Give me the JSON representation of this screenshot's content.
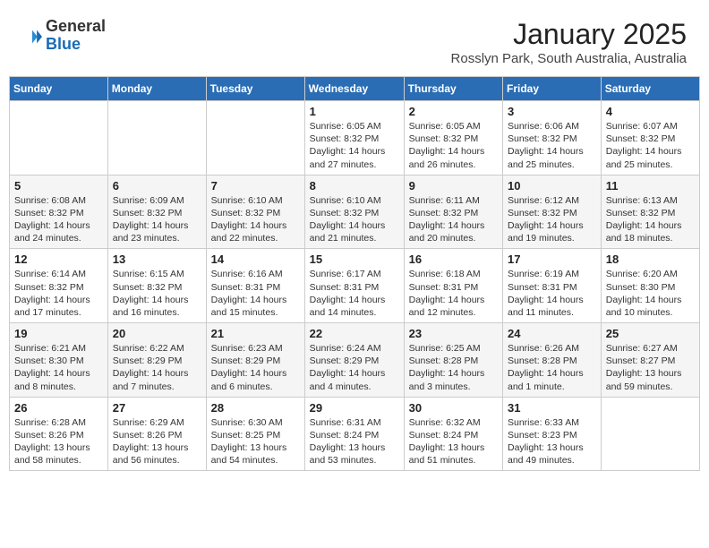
{
  "header": {
    "logo": {
      "general": "General",
      "blue": "Blue"
    },
    "title": "January 2025",
    "subtitle": "Rosslyn Park, South Australia, Australia"
  },
  "calendar": {
    "days_of_week": [
      "Sunday",
      "Monday",
      "Tuesday",
      "Wednesday",
      "Thursday",
      "Friday",
      "Saturday"
    ],
    "weeks": [
      [
        {
          "day": "",
          "info": ""
        },
        {
          "day": "",
          "info": ""
        },
        {
          "day": "",
          "info": ""
        },
        {
          "day": "1",
          "info": "Sunrise: 6:05 AM\nSunset: 8:32 PM\nDaylight: 14 hours\nand 27 minutes."
        },
        {
          "day": "2",
          "info": "Sunrise: 6:05 AM\nSunset: 8:32 PM\nDaylight: 14 hours\nand 26 minutes."
        },
        {
          "day": "3",
          "info": "Sunrise: 6:06 AM\nSunset: 8:32 PM\nDaylight: 14 hours\nand 25 minutes."
        },
        {
          "day": "4",
          "info": "Sunrise: 6:07 AM\nSunset: 8:32 PM\nDaylight: 14 hours\nand 25 minutes."
        }
      ],
      [
        {
          "day": "5",
          "info": "Sunrise: 6:08 AM\nSunset: 8:32 PM\nDaylight: 14 hours\nand 24 minutes."
        },
        {
          "day": "6",
          "info": "Sunrise: 6:09 AM\nSunset: 8:32 PM\nDaylight: 14 hours\nand 23 minutes."
        },
        {
          "day": "7",
          "info": "Sunrise: 6:10 AM\nSunset: 8:32 PM\nDaylight: 14 hours\nand 22 minutes."
        },
        {
          "day": "8",
          "info": "Sunrise: 6:10 AM\nSunset: 8:32 PM\nDaylight: 14 hours\nand 21 minutes."
        },
        {
          "day": "9",
          "info": "Sunrise: 6:11 AM\nSunset: 8:32 PM\nDaylight: 14 hours\nand 20 minutes."
        },
        {
          "day": "10",
          "info": "Sunrise: 6:12 AM\nSunset: 8:32 PM\nDaylight: 14 hours\nand 19 minutes."
        },
        {
          "day": "11",
          "info": "Sunrise: 6:13 AM\nSunset: 8:32 PM\nDaylight: 14 hours\nand 18 minutes."
        }
      ],
      [
        {
          "day": "12",
          "info": "Sunrise: 6:14 AM\nSunset: 8:32 PM\nDaylight: 14 hours\nand 17 minutes."
        },
        {
          "day": "13",
          "info": "Sunrise: 6:15 AM\nSunset: 8:32 PM\nDaylight: 14 hours\nand 16 minutes."
        },
        {
          "day": "14",
          "info": "Sunrise: 6:16 AM\nSunset: 8:31 PM\nDaylight: 14 hours\nand 15 minutes."
        },
        {
          "day": "15",
          "info": "Sunrise: 6:17 AM\nSunset: 8:31 PM\nDaylight: 14 hours\nand 14 minutes."
        },
        {
          "day": "16",
          "info": "Sunrise: 6:18 AM\nSunset: 8:31 PM\nDaylight: 14 hours\nand 12 minutes."
        },
        {
          "day": "17",
          "info": "Sunrise: 6:19 AM\nSunset: 8:31 PM\nDaylight: 14 hours\nand 11 minutes."
        },
        {
          "day": "18",
          "info": "Sunrise: 6:20 AM\nSunset: 8:30 PM\nDaylight: 14 hours\nand 10 minutes."
        }
      ],
      [
        {
          "day": "19",
          "info": "Sunrise: 6:21 AM\nSunset: 8:30 PM\nDaylight: 14 hours\nand 8 minutes."
        },
        {
          "day": "20",
          "info": "Sunrise: 6:22 AM\nSunset: 8:29 PM\nDaylight: 14 hours\nand 7 minutes."
        },
        {
          "day": "21",
          "info": "Sunrise: 6:23 AM\nSunset: 8:29 PM\nDaylight: 14 hours\nand 6 minutes."
        },
        {
          "day": "22",
          "info": "Sunrise: 6:24 AM\nSunset: 8:29 PM\nDaylight: 14 hours\nand 4 minutes."
        },
        {
          "day": "23",
          "info": "Sunrise: 6:25 AM\nSunset: 8:28 PM\nDaylight: 14 hours\nand 3 minutes."
        },
        {
          "day": "24",
          "info": "Sunrise: 6:26 AM\nSunset: 8:28 PM\nDaylight: 14 hours\nand 1 minute."
        },
        {
          "day": "25",
          "info": "Sunrise: 6:27 AM\nSunset: 8:27 PM\nDaylight: 13 hours\nand 59 minutes."
        }
      ],
      [
        {
          "day": "26",
          "info": "Sunrise: 6:28 AM\nSunset: 8:26 PM\nDaylight: 13 hours\nand 58 minutes."
        },
        {
          "day": "27",
          "info": "Sunrise: 6:29 AM\nSunset: 8:26 PM\nDaylight: 13 hours\nand 56 minutes."
        },
        {
          "day": "28",
          "info": "Sunrise: 6:30 AM\nSunset: 8:25 PM\nDaylight: 13 hours\nand 54 minutes."
        },
        {
          "day": "29",
          "info": "Sunrise: 6:31 AM\nSunset: 8:24 PM\nDaylight: 13 hours\nand 53 minutes."
        },
        {
          "day": "30",
          "info": "Sunrise: 6:32 AM\nSunset: 8:24 PM\nDaylight: 13 hours\nand 51 minutes."
        },
        {
          "day": "31",
          "info": "Sunrise: 6:33 AM\nSunset: 8:23 PM\nDaylight: 13 hours\nand 49 minutes."
        },
        {
          "day": "",
          "info": ""
        }
      ]
    ]
  }
}
